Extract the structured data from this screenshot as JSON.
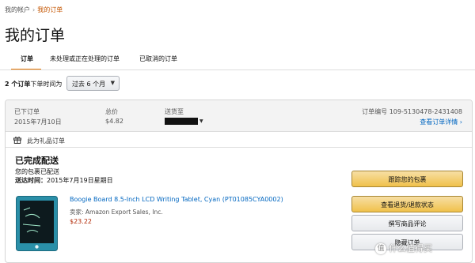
{
  "breadcrumb": {
    "home": "我的帐户",
    "current": "我的订单"
  },
  "page": {
    "title": "我的订单"
  },
  "tabs": [
    {
      "label": "订单",
      "active": true
    },
    {
      "label": "未处理或正在处理的订单",
      "active": false
    },
    {
      "label": "已取消的订单",
      "active": false
    }
  ],
  "filter": {
    "count_text": "2 个订单",
    "label": "下单时间为",
    "selected": "过去 6 个月"
  },
  "order": {
    "placed_label": "已下订单",
    "placed_date": "2015年7月10日",
    "total_label": "总价",
    "total": "$4.82",
    "ship_to_label": "送货至",
    "order_no_label": "订单编号",
    "order_no": "109-5130478-2431408",
    "details_link": "查看订单详情",
    "gift_label": "此为礼品订单",
    "status_title": "已完成配送",
    "status_sub": "您的包裹已配送",
    "arrival_label": "送达时间：",
    "arrival_date": "2015年7月19日星期日",
    "item": {
      "title": "Boogie Board 8.5-Inch LCD Writing Tablet, Cyan (PT01085CYA0002)",
      "seller_label": "卖家:",
      "seller": "Amazon Export Sales, Inc.",
      "price": "$23.22"
    },
    "buttons": {
      "track": "跟踪您的包裹",
      "return": "查看退货/退款状态",
      "review": "撰写商品评论",
      "hide": "隐藏订单"
    }
  },
  "colors": {
    "link": "#0066c0",
    "accent": "#e77600",
    "price": "#b12704",
    "primary_button": "#f0c14b"
  },
  "watermark": {
    "icon_text": "值",
    "text": "什么值得买"
  }
}
